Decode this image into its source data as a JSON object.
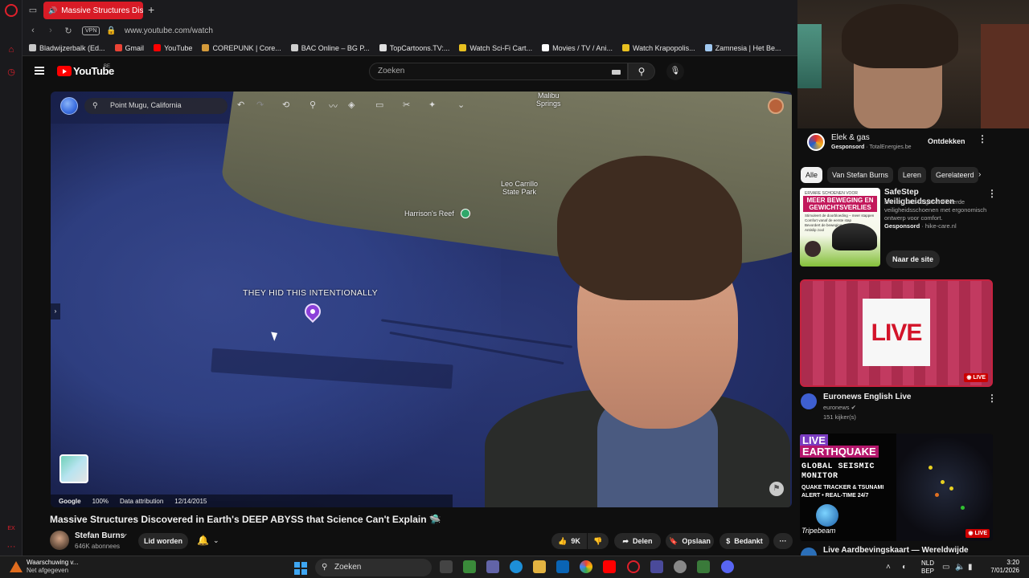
{
  "browser": {
    "active_tab_title": "Massive Structures Dis",
    "url": "www.youtube.com/watch",
    "vpn_label": "VPN",
    "bookmarks": [
      {
        "label": "Bladwijzerbalk (Ed...",
        "color": "#c8c8c8"
      },
      {
        "label": "Gmail",
        "color": "#ea4335"
      },
      {
        "label": "YouTube",
        "color": "#ff0000"
      },
      {
        "label": "COREPUNK | Core...",
        "color": "#d49a3a"
      },
      {
        "label": "BAC Online – BG P...",
        "color": "#cfcfcf"
      },
      {
        "label": "TopCartoons.TV:...",
        "color": "#e0e0e0"
      },
      {
        "label": "Watch Sci-Fi Cart...",
        "color": "#e8c020"
      },
      {
        "label": "Movies / TV / Ani...",
        "color": "#ffffff"
      },
      {
        "label": "Watch Krapopolis...",
        "color": "#e8c020"
      },
      {
        "label": "Zamnesia | Het Be...",
        "color": "#a0c8f0"
      }
    ]
  },
  "youtube": {
    "logo_text": "YouTube",
    "country_code": "BE",
    "search_placeholder": "Zoeken"
  },
  "video": {
    "map_search": "Point Mugu, California",
    "labels": {
      "malibu_springs": "Malibu\nSprings",
      "leo_carrillo": "Leo Carrillo\nState Park",
      "harrisons_reef": "Harrison's Reef",
      "annotation": "THEY HID THIS INTENTIONALLY"
    },
    "footer": {
      "google": "Google",
      "zoom": "100%",
      "attribution": "Data attribution",
      "date": "12/14/2015"
    },
    "title": "Massive Structures Discovered in Earth's DEEP ABYSS that Science Can't Explain 🛸",
    "channel_name": "Stefan Burns",
    "verified_icon": "✔",
    "subscribers": "646K abonnees",
    "join_label": "Lid worden",
    "likes": "9K",
    "share_label": "Delen",
    "save_label": "Opslaan",
    "thanks_label": "Bedankt",
    "more_label": "···"
  },
  "sidebar": {
    "ad1": {
      "name": "Elek & gas",
      "sponsored": "Gesponsord",
      "advertiser": "TotalEnergies.be",
      "cta": "Ontdekken"
    },
    "chips": [
      "Alle",
      "Van Stefan Burns",
      "Leren",
      "Gerelateerd"
    ],
    "ad2": {
      "thumb_header": "ERVARE SCHOENEN VOOR",
      "thumb_big": "MEER BEWEGING EN GEWICHTSVERLIES",
      "thumb_lines": [
        "Stimuleert de doorbloeding – meer stappen",
        "Comfort vanaf de eerste stap",
        "Bevordert de beweging",
        "Antislip zool"
      ],
      "title": "SafeStep Veiligheidsschoen",
      "desc": "EN ISO 20345-gecertificeerde veiligheidsschoenen met ergonomisch ontwerp voor comfort.",
      "sponsored": "Gesponsord",
      "advertiser": "hike-care.nl",
      "cta": "Naar de site"
    },
    "live1": {
      "thumb_text": "LIVE",
      "badge": "LIVE",
      "title": "Euronews English Live",
      "channel": "euronews",
      "viewers": "151 kijker(s)"
    },
    "live2": {
      "line1": "LIVE",
      "line2": "EARTHQUAKE",
      "line3": "GLOBAL SEISMIC",
      "line4": "MONITOR",
      "line5": "QUAKE TRACKER & TSUNAMI",
      "line6": "ALERT • REAL-TIME 24/7",
      "brand": "Tripebeam",
      "badge": "LIVE",
      "title": "Live Aardbevingskaart — Wereldwijde"
    }
  },
  "taskbar": {
    "warning_title": "Waarschuwing v...",
    "warning_sub": "Net afgegeven",
    "search_label": "Zoeken",
    "lang": "NLD",
    "lang_sub": "BEP",
    "time": "3:20",
    "date": "7/01/2026"
  }
}
